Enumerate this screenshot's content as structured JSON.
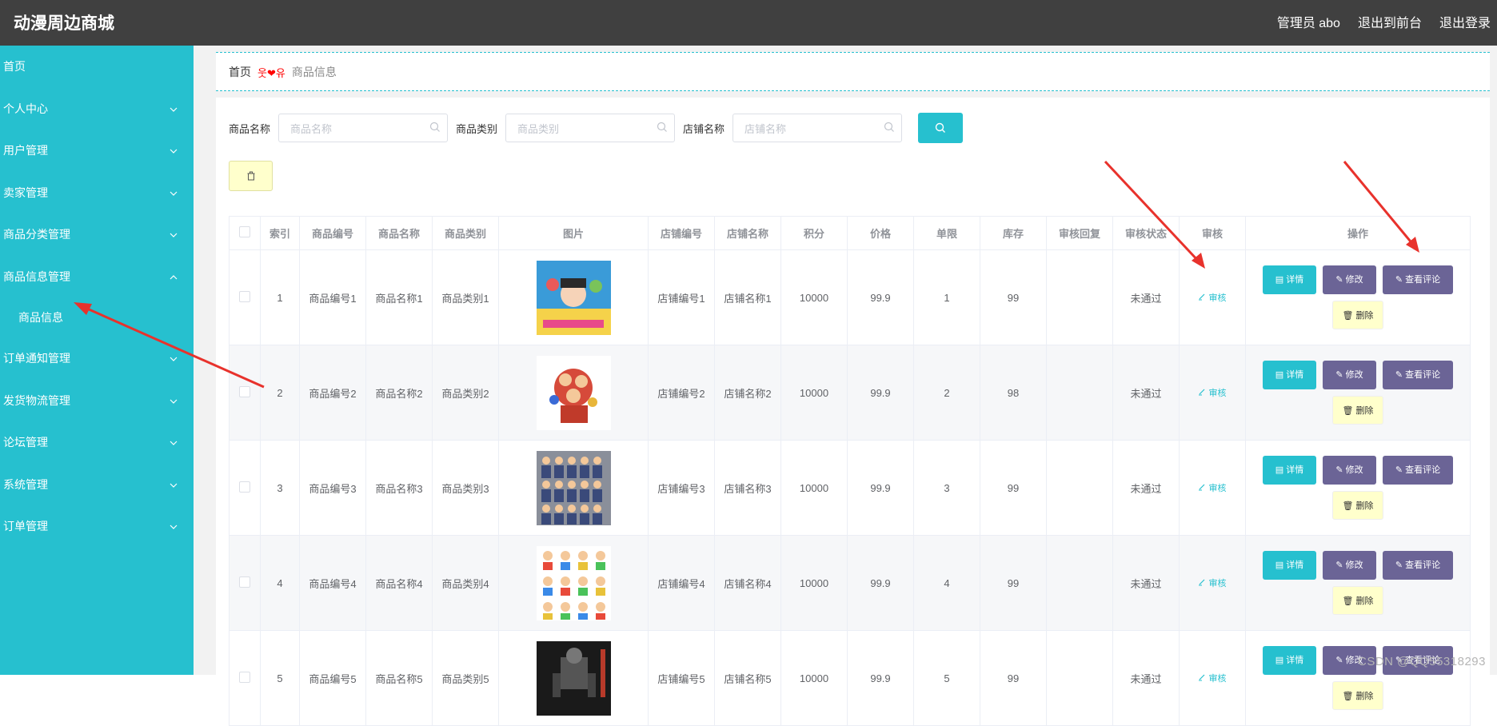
{
  "header": {
    "title": "动漫周边商城",
    "admin_label": "管理员 abo",
    "exit_front": "退出到前台",
    "logout": "退出登录"
  },
  "sidebar": {
    "items": [
      {
        "label": "首页",
        "chevron": false
      },
      {
        "label": "个人中心",
        "chevron": true
      },
      {
        "label": "用户管理",
        "chevron": true
      },
      {
        "label": "卖家管理",
        "chevron": true
      },
      {
        "label": "商品分类管理",
        "chevron": true
      },
      {
        "label": "商品信息管理",
        "chevron": true,
        "expanded": true
      },
      {
        "label": "订单通知管理",
        "chevron": true
      },
      {
        "label": "发货物流管理",
        "chevron": true
      },
      {
        "label": "论坛管理",
        "chevron": true
      },
      {
        "label": "系统管理",
        "chevron": true
      },
      {
        "label": "订单管理",
        "chevron": true
      }
    ],
    "subitem": "商品信息"
  },
  "breadcrumb": {
    "home": "首页",
    "separator": "웃❤유",
    "current": "商品信息"
  },
  "search": {
    "name_label": "商品名称",
    "name_placeholder": "商品名称",
    "category_label": "商品类别",
    "category_placeholder": "商品类别",
    "shop_label": "店铺名称",
    "shop_placeholder": "店铺名称"
  },
  "table": {
    "headers": [
      "索引",
      "商品编号",
      "商品名称",
      "商品类别",
      "图片",
      "店铺编号",
      "店铺名称",
      "积分",
      "价格",
      "单限",
      "库存",
      "审核回复",
      "审核状态",
      "审核",
      "操作"
    ],
    "rows": [
      {
        "index": "1",
        "code": "商品编号1",
        "name": "商品名称1",
        "category": "商品类别1",
        "shop_code": "店铺编号1",
        "shop_name": "店铺名称1",
        "points": "10000",
        "price": "99.9",
        "limit": "1",
        "stock": "99",
        "reply": "",
        "status": "未通过"
      },
      {
        "index": "2",
        "code": "商品编号2",
        "name": "商品名称2",
        "category": "商品类别2",
        "shop_code": "店铺编号2",
        "shop_name": "店铺名称2",
        "points": "10000",
        "price": "99.9",
        "limit": "2",
        "stock": "98",
        "reply": "",
        "status": "未通过"
      },
      {
        "index": "3",
        "code": "商品编号3",
        "name": "商品名称3",
        "category": "商品类别3",
        "shop_code": "店铺编号3",
        "shop_name": "店铺名称3",
        "points": "10000",
        "price": "99.9",
        "limit": "3",
        "stock": "99",
        "reply": "",
        "status": "未通过"
      },
      {
        "index": "4",
        "code": "商品编号4",
        "name": "商品名称4",
        "category": "商品类别4",
        "shop_code": "店铺编号4",
        "shop_name": "店铺名称4",
        "points": "10000",
        "price": "99.9",
        "limit": "4",
        "stock": "99",
        "reply": "",
        "status": "未通过"
      },
      {
        "index": "5",
        "code": "商品编号5",
        "name": "商品名称5",
        "category": "商品类别5",
        "shop_code": "店铺编号5",
        "shop_name": "店铺名称5",
        "points": "10000",
        "price": "99.9",
        "limit": "5",
        "stock": "99",
        "reply": "",
        "status": "未通过"
      }
    ],
    "audit_label": "审核",
    "actions": {
      "detail": "详情",
      "edit": "修改",
      "review": "查看评论",
      "delete": "删除"
    }
  },
  "watermark": "CSDN @QQ55318293",
  "colors": {
    "sidebar": "#26c0cf",
    "header": "#404040",
    "accent": "#26c0cf",
    "purple_button": "#6b6496",
    "delete_button": "#ffffcc",
    "annotation_arrow": "#e8322c",
    "breadcrumb_separator": "#ff0000"
  }
}
